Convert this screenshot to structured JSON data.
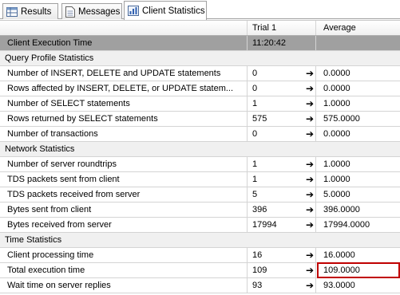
{
  "tabs": [
    {
      "label": "Results",
      "icon": "grid-icon"
    },
    {
      "label": "Messages",
      "icon": "document-icon"
    },
    {
      "label": "Client Statistics",
      "icon": "statistics-icon",
      "active": true
    }
  ],
  "columns": [
    "",
    "Trial 1",
    "Average"
  ],
  "selected_row": {
    "label": "Client Execution Time",
    "trial": "11:20:42",
    "average": ""
  },
  "sections": [
    {
      "title": "Query Profile Statistics",
      "rows": [
        {
          "label": "Number of INSERT, DELETE and UPDATE statements",
          "trial": "0",
          "average": "0.0000"
        },
        {
          "label": "Rows affected by INSERT, DELETE, or UPDATE statem...",
          "trial": "0",
          "average": "0.0000"
        },
        {
          "label": "Number of SELECT statements",
          "trial": "1",
          "average": "1.0000"
        },
        {
          "label": "Rows returned by SELECT statements",
          "trial": "575",
          "average": "575.0000"
        },
        {
          "label": "Number of transactions",
          "trial": "0",
          "average": "0.0000"
        }
      ]
    },
    {
      "title": "Network Statistics",
      "rows": [
        {
          "label": "Number of server roundtrips",
          "trial": "1",
          "average": "1.0000"
        },
        {
          "label": "TDS packets sent from client",
          "trial": "1",
          "average": "1.0000"
        },
        {
          "label": "TDS packets received from server",
          "trial": "5",
          "average": "5.0000"
        },
        {
          "label": "Bytes sent from client",
          "trial": "396",
          "average": "396.0000"
        },
        {
          "label": "Bytes received from server",
          "trial": "17994",
          "average": "17994.0000"
        }
      ]
    },
    {
      "title": "Time Statistics",
      "rows": [
        {
          "label": "Client processing time",
          "trial": "16",
          "average": "16.0000"
        },
        {
          "label": "Total execution time",
          "trial": "109",
          "average": "109.0000",
          "highlighted": true
        },
        {
          "label": "Wait time on server replies",
          "trial": "93",
          "average": "93.0000"
        }
      ]
    }
  ],
  "arrow_glyph": "➔",
  "colors": {
    "highlight_border": "#c00000",
    "selected_row": "#a0a0a0",
    "section_bg": "#f0f0f0"
  }
}
